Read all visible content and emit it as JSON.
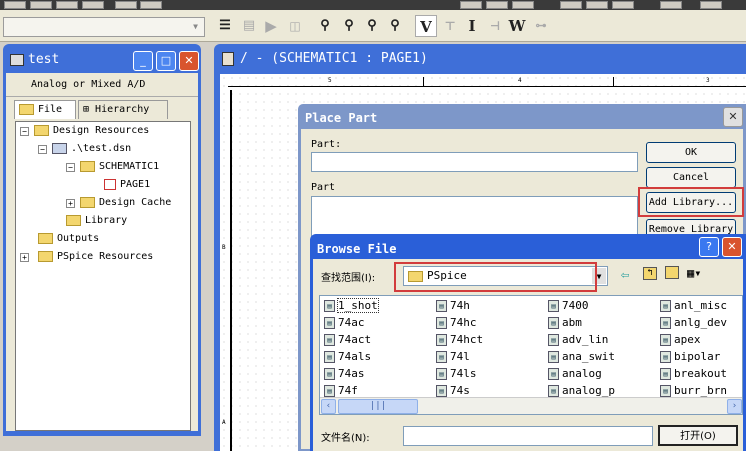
{
  "toolbar": {
    "buttons": [
      "V",
      "I",
      "W"
    ]
  },
  "project": {
    "title": "test",
    "mode": "Analog or Mixed A/D",
    "tabs": [
      "File",
      "Hierarchy"
    ],
    "tree": [
      "Design Resources",
      ".\\test.dsn",
      "SCHEMATIC1",
      "PAGE1",
      "Design Cache",
      "Library",
      "Outputs",
      "PSpice Resources"
    ]
  },
  "schematic": {
    "title": "/ - (SCHEMATIC1 : PAGE1)",
    "ruler": [
      "5",
      "4",
      "3"
    ],
    "side_marks": [
      "B",
      "A"
    ]
  },
  "place_part": {
    "title": "Place Part",
    "part_label": "Part:",
    "part_value": "",
    "part_list_label": "Part",
    "buttons": {
      "ok": "OK",
      "cancel": "Cancel",
      "add_library": "Add Library...",
      "remove_library": "Remove Library"
    }
  },
  "browse": {
    "title": "Browse File",
    "lookin_label": "查找范围(I):",
    "lookin_value": "PSpice",
    "filename_label": "文件名(N):",
    "filename_value": "",
    "open": "打开(O)",
    "files": [
      "1_shot",
      "74ac",
      "74act",
      "74als",
      "74as",
      "74f",
      "74h",
      "74hc",
      "74hct",
      "74l",
      "74ls",
      "74s",
      "7400",
      "abm",
      "adv_lin",
      "ana_swit",
      "analog",
      "analog_p",
      "anl_misc",
      "anlg_dev",
      "apex",
      "bipolar",
      "breakout",
      "burr_brn"
    ]
  }
}
